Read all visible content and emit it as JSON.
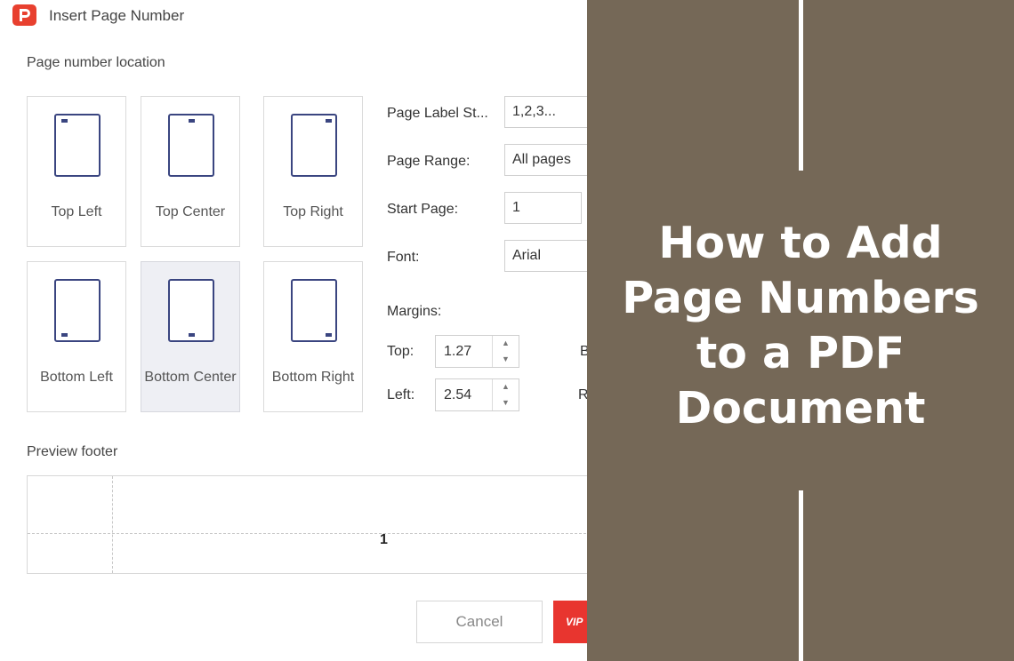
{
  "dialog": {
    "title": "Insert Page Number",
    "location_label": "Page number location",
    "locations": [
      {
        "label": "Top Left"
      },
      {
        "label": "Top Center"
      },
      {
        "label": "Top Right"
      },
      {
        "label": "Bottom Left"
      },
      {
        "label": "Bottom Center",
        "selected": true
      },
      {
        "label": "Bottom Right"
      }
    ],
    "fields": {
      "label_style": {
        "label": "Page Label St...",
        "value": "1,2,3..."
      },
      "page_range": {
        "label": "Page Range:",
        "value": "All pages"
      },
      "start_page": {
        "label": "Start Page:",
        "value": "1"
      },
      "font": {
        "label": "Font:",
        "value": "Arial"
      }
    },
    "margins": {
      "label": "Margins:",
      "top": {
        "label": "Top:",
        "value": "1.27"
      },
      "left": {
        "label": "Left:",
        "value": "2.54"
      },
      "bottom_cut": "B",
      "right_cut": "R"
    },
    "preview": {
      "label": "Preview footer",
      "number": "1"
    },
    "buttons": {
      "cancel": "Cancel",
      "apply_partial": "VIP"
    }
  },
  "article": {
    "headline_lines": [
      "How to Add",
      "Page Numbers",
      "to a PDF",
      "Document"
    ],
    "background_color": "#756857",
    "text_color": "#ffffff"
  },
  "colors": {
    "brand_red": "#e8402f",
    "selected_tile": "#eeeff4",
    "page_icon": "#3a4580"
  }
}
